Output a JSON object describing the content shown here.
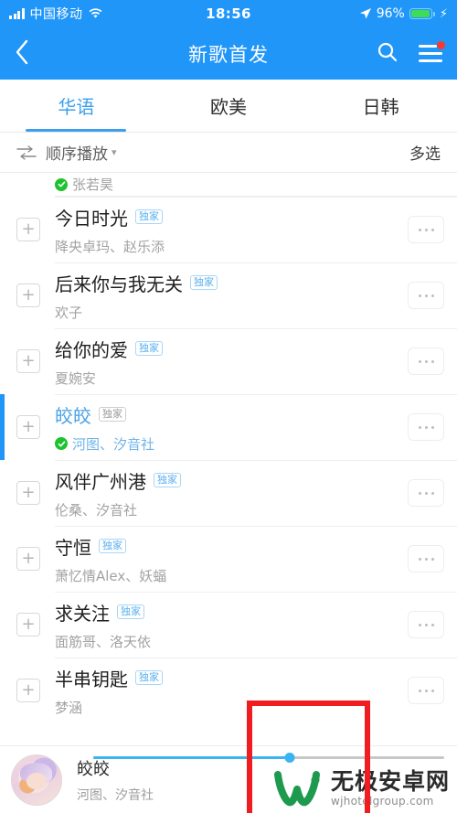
{
  "status_bar": {
    "carrier": "中国移动",
    "time": "18:56",
    "battery_percent": "96%",
    "signal_icon": "signal-bars-icon",
    "wifi_icon": "wifi-icon",
    "location_icon": "location-arrow-icon",
    "charging_icon": "lightning-bolt-icon"
  },
  "header": {
    "title": "新歌首发",
    "back_icon": "chevron-left-icon",
    "search_icon": "search-icon",
    "menu_icon": "hamburger-menu-icon",
    "has_badge": true,
    "accent_color": "#2196f9"
  },
  "tabs": [
    {
      "label": "华语",
      "active": true
    },
    {
      "label": "欧美",
      "active": false
    },
    {
      "label": "日韩",
      "active": false
    }
  ],
  "toolbar": {
    "sort_icon": "order-play-icon",
    "sort_label": "顺序播放",
    "chevron_icon": "chevron-down-icon",
    "multi_select_label": "多选"
  },
  "partial_row": {
    "artist": "张若昊",
    "verified": true
  },
  "songs": [
    {
      "title": "今日时光",
      "badge": "独家",
      "artist": "降央卓玛、赵乐添",
      "verified": false,
      "playing": false,
      "add_icon": "plus-icon",
      "more_icon": "more-dots-icon"
    },
    {
      "title": "后来你与我无关",
      "badge": "独家",
      "artist": "欢子",
      "verified": false,
      "playing": false,
      "add_icon": "plus-icon",
      "more_icon": "more-dots-icon"
    },
    {
      "title": "给你的爱",
      "badge": "独家",
      "artist": "夏婉安",
      "verified": false,
      "playing": false,
      "add_icon": "plus-icon",
      "more_icon": "more-dots-icon"
    },
    {
      "title": "皎皎",
      "badge": "独家",
      "artist": "河图、汐音社",
      "verified": true,
      "playing": true,
      "add_icon": "plus-icon",
      "more_icon": "more-dots-icon"
    },
    {
      "title": "风伴广州港",
      "badge": "独家",
      "artist": "伦桑、汐音社",
      "verified": false,
      "playing": false,
      "add_icon": "plus-icon",
      "more_icon": "more-dots-icon"
    },
    {
      "title": "守恒",
      "badge": "独家",
      "artist": "萧忆情Alex、妖蝠",
      "verified": false,
      "playing": false,
      "add_icon": "plus-icon",
      "more_icon": "more-dots-icon"
    },
    {
      "title": "求关注",
      "badge": "独家",
      "artist": "面筋哥、洛天依",
      "verified": false,
      "playing": false,
      "add_icon": "plus-icon",
      "more_icon": "more-dots-icon"
    },
    {
      "title": "半串钥匙",
      "badge": "独家",
      "artist": "梦涵",
      "verified": false,
      "playing": false,
      "add_icon": "plus-icon",
      "more_icon": "more-dots-icon"
    }
  ],
  "player": {
    "title": "皎皎",
    "artist": "河图、汐音社",
    "album_art_icon": "album-art-thumbnail",
    "progress_percent": 56,
    "progress_color": "#3ab3f2"
  },
  "watermark": {
    "site_name": "无极安卓网",
    "url": "wjhotelgroup.com",
    "logo_icon": "w-logo-icon",
    "logo_color": "#1d9a4e"
  },
  "annotation": {
    "shape": "red-rectangle-highlight",
    "color": "#ef1c20"
  }
}
